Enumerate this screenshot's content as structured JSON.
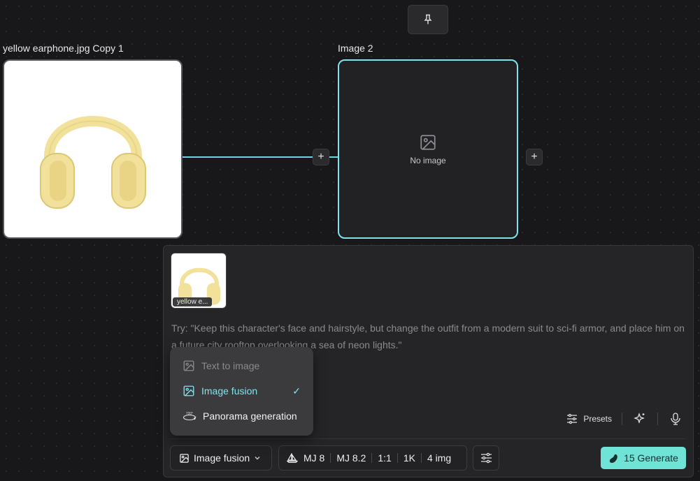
{
  "canvas": {
    "pin_icon": "pin-icon",
    "node1": {
      "title": "yellow earphone.jpg Copy 1",
      "image": "yellow-headphones-photo"
    },
    "node2": {
      "title": "Image 2",
      "empty_text": "No image",
      "empty_icon": "image-placeholder-icon"
    },
    "plus_label": "+"
  },
  "panel": {
    "attachment": {
      "label": "yellow e...",
      "image": "yellow-headphones-thumbnail"
    },
    "prompt_placeholder": "Try: \"Keep this character's face and hairstyle, but change the outfit from a modern suit to sci-fi armor, and place him on a future city rooftop overlooking a sea of neon lights.\"",
    "tools": {
      "presets_label": "Presets",
      "magic_icon": "sparkle-icon",
      "mic_icon": "microphone-icon"
    },
    "mode_button": {
      "label": "Image fusion",
      "icon": "image-icon",
      "chevron": "chevron-down-icon"
    },
    "model_group": {
      "icon": "sailboat-icon",
      "model_a": "MJ 8",
      "model_b": "MJ 8.2",
      "ratio": "1:1",
      "resolution": "1K",
      "count": "4 img"
    },
    "settings_icon": "sliders-icon",
    "generate": {
      "label": "15 Generate",
      "icon": "credit-bean-icon"
    }
  },
  "dropdown": {
    "items": [
      {
        "label": "Text to image",
        "icon": "image-icon",
        "state": "disabled"
      },
      {
        "label": "Image fusion",
        "icon": "image-icon",
        "state": "selected",
        "check": "✓"
      },
      {
        "label": "Panorama generation",
        "icon": "panorama-720-icon",
        "state": "normal"
      }
    ]
  },
  "colors": {
    "accent": "#7fe3ee",
    "generate_bg": "#6fe3d6",
    "canvas_bg": "#18181a",
    "panel_bg": "#252527"
  }
}
